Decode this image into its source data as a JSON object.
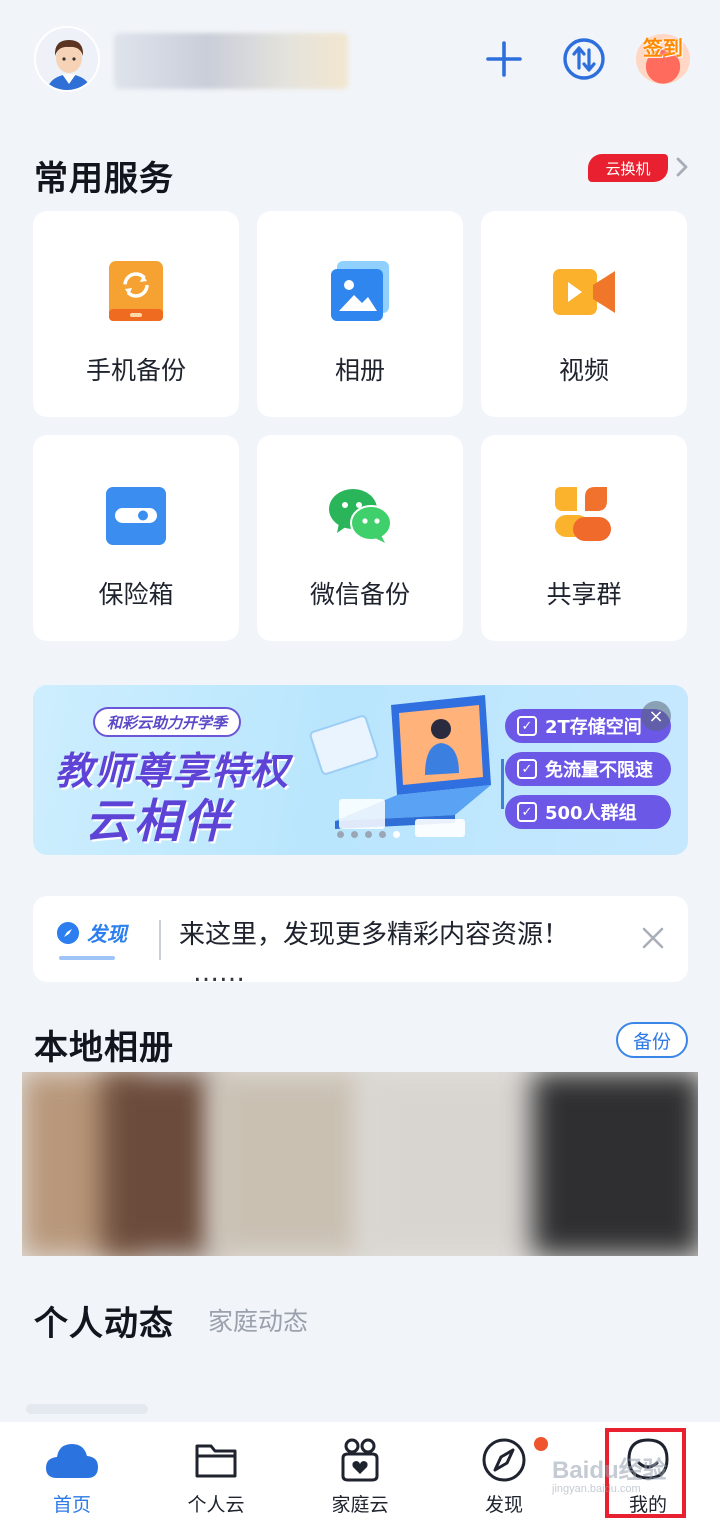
{
  "header": {
    "username": "",
    "checkin_label": "签到"
  },
  "services": {
    "title": "常用服务",
    "promo_tag": "云换机",
    "items": [
      {
        "label": "手机备份",
        "icon": "phone-backup-icon"
      },
      {
        "label": "相册",
        "icon": "album-icon"
      },
      {
        "label": "视频",
        "icon": "video-icon"
      },
      {
        "label": "保险箱",
        "icon": "safe-icon"
      },
      {
        "label": "微信备份",
        "icon": "wechat-backup-icon"
      },
      {
        "label": "共享群",
        "icon": "share-group-icon"
      }
    ]
  },
  "banner": {
    "pill": "和彩云助力开学季",
    "headline": "教师尊享特权",
    "subheadline": "云相伴",
    "features": [
      "2T存储空间",
      "免流量不限速",
      "500人群组"
    ],
    "close": "×"
  },
  "notice": {
    "tag": "发现",
    "text": "来这里，发现更多精彩内容资源！",
    "text_next": "……"
  },
  "local_album": {
    "title": "本地相册",
    "backup_label": "备份"
  },
  "activity": {
    "tab_personal": "个人动态",
    "tab_family": "家庭动态"
  },
  "bottom_nav": [
    {
      "label": "首页",
      "icon": "cloud-icon",
      "active": true
    },
    {
      "label": "个人云",
      "icon": "folder-icon",
      "active": false
    },
    {
      "label": "家庭云",
      "icon": "family-icon",
      "active": false
    },
    {
      "label": "发现",
      "icon": "compass-icon",
      "active": false
    },
    {
      "label": "我的",
      "icon": "profile-icon",
      "active": false
    }
  ],
  "watermark": {
    "text": "Baidu经验",
    "sub": "jingyan.baidu.com"
  },
  "colors": {
    "accent": "#2d7ae6",
    "promo_red": "#e8202f",
    "banner_purple": "#5d43d6",
    "background": "#f1f4f8"
  }
}
